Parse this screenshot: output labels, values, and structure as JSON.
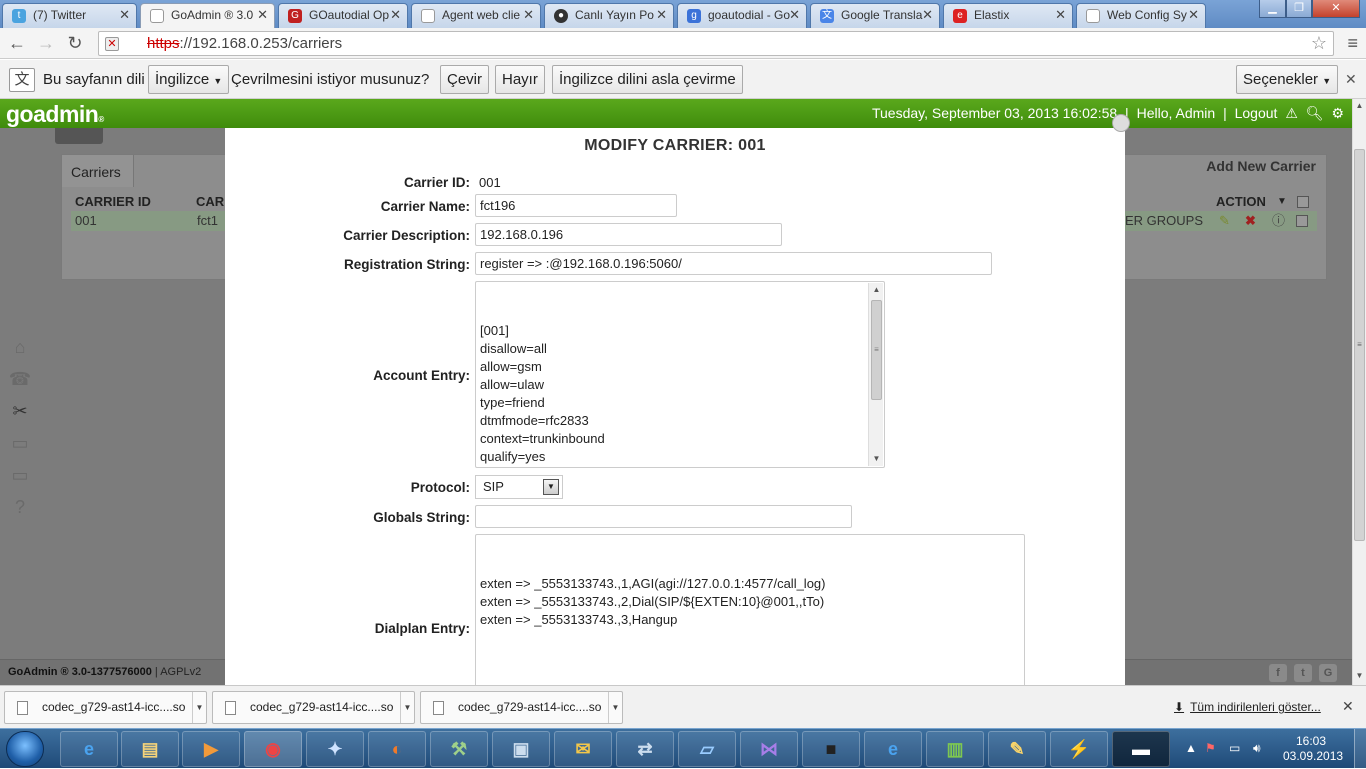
{
  "browser": {
    "tabs": [
      {
        "label": "(7) Twitter",
        "icon": "twitter-icon",
        "active": false
      },
      {
        "label": "GoAdmin ® 3.0",
        "icon": "page-icon",
        "active": true
      },
      {
        "label": "GOautodial Op",
        "icon": "goautodial-icon",
        "active": false
      },
      {
        "label": "Agent web clie",
        "icon": "page-icon",
        "active": false
      },
      {
        "label": "Canlı Yayın Po",
        "icon": "live-stream-icon",
        "active": false
      },
      {
        "label": "goautodial - Go",
        "icon": "google-icon",
        "active": false
      },
      {
        "label": "Google Transla",
        "icon": "google-translate-icon",
        "active": false
      },
      {
        "label": "Elastix",
        "icon": "elastix-icon",
        "active": false
      },
      {
        "label": "Web Config Sy",
        "icon": "page-icon",
        "active": false
      }
    ],
    "url_scheme": "https",
    "url_rest": "://192.168.0.253/carriers"
  },
  "translate_bar": {
    "prefix": "Bu sayfanın dili",
    "language": "İngilizce",
    "question": "Çevrilmesini istiyor musunuz?",
    "translate_btn": "Çevir",
    "no_btn": "Hayır",
    "never_btn": "İngilizce dilini asla çevirme",
    "options_btn": "Seçenekler"
  },
  "app_header": {
    "logo": "goadmin",
    "datetime": "Tuesday, September 03, 2013 16:02:58",
    "sep": "|",
    "greeting": "Hello, Admin",
    "logout": "Logout"
  },
  "background_page": {
    "tab_label": "Carriers",
    "add_new": "Add New Carrier",
    "col_carrier_id": "CARRIER ID",
    "col_carrier_name": "CAR",
    "col_action": "ACTION",
    "row_id": "001",
    "row_name": "fct1",
    "row_groups": "ER GROUPS",
    "footer_version": "GoAdmin ® 3.0-1377576000",
    "footer_license": "AGPLv2"
  },
  "modal": {
    "title": "MODIFY CARRIER: 001",
    "carrier_id_label": "Carrier ID:",
    "carrier_id_value": "001",
    "carrier_name_label": "Carrier Name:",
    "carrier_name_value": "fct196",
    "carrier_desc_label": "Carrier Description:",
    "carrier_desc_value": "192.168.0.196",
    "reg_string_label": "Registration String:",
    "reg_string_value": "register => :@192.168.0.196:5060/",
    "account_entry_label": "Account Entry:",
    "account_entry_value": "[001]\ndisallow=all\nallow=gsm\nallow=ulaw\ntype=friend\ndtmfmode=rfc2833\ncontext=trunkinbound\nqualify=yes\ninsecure=very\nnat=yes",
    "protocol_label": "Protocol:",
    "protocol_value": "SIP",
    "globals_label": "Globals String:",
    "globals_value": "",
    "dialplan_label": "Dialplan Entry:",
    "dialplan_value": "exten => _5553133743.,1,AGI(agi://127.0.0.1:4577/call_log)\nexten => _5553133743.,2,Dial(SIP/${EXTEN:10}@001,,tTo)\nexten => _5553133743.,3,Hangup"
  },
  "downloads": {
    "items": [
      "codec_g729-ast14-icc....so",
      "codec_g729-ast14-icc....so",
      "codec_g729-ast14-icc....so"
    ],
    "show_all": "Tüm indirilenleri göster..."
  },
  "taskbar": {
    "apps": [
      "internet-explorer-icon",
      "file-explorer-icon",
      "media-player-icon",
      "chrome-icon",
      "unknown-blue-app-icon",
      "firefox-icon",
      "network-tool-icon",
      "remote-desktop-icon",
      "outlook-icon",
      "network-connections-icon",
      "notes-icon",
      "visual-studio-icon",
      "terminal-app-icon",
      "internet-explorer-icon",
      "spreadsheet-icon",
      "paint-icon",
      "winscp-icon",
      "command-prompt-icon"
    ],
    "clock_time": "16:03",
    "clock_date": "03.09.2013"
  },
  "colors": {
    "app_header_green": "#4a9b12",
    "tabstrip_blue": "#6a94c8",
    "taskbar_blue": "#1f4a78"
  }
}
